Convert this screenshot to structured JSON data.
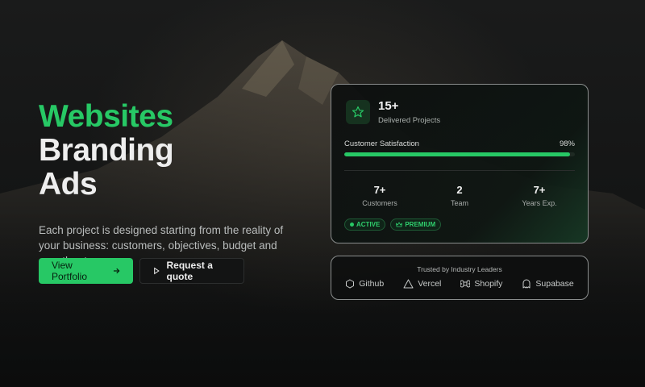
{
  "hero": {
    "line1": "Websites",
    "line2": "Branding",
    "line3": "Ads",
    "description": "Each project is designed starting from the reality of your business: customers, objectives, budget and growth rate."
  },
  "cta": {
    "primary_label": "View Portfolio",
    "secondary_label": "Request a quote"
  },
  "stats_card": {
    "projects_count": "15+",
    "projects_label": "Delivered Projects",
    "satisfaction_label": "Customer Satisfaction",
    "satisfaction_value": "98%",
    "satisfaction_fraction": 0.98,
    "stats": [
      {
        "value": "7+",
        "label": "Customers"
      },
      {
        "value": "2",
        "label": "Team"
      },
      {
        "value": "7+",
        "label": "Years Exp."
      }
    ],
    "badges": [
      {
        "label": "ACTIVE",
        "icon": "dot-icon"
      },
      {
        "label": "PREMIUM",
        "icon": "crown-icon"
      }
    ]
  },
  "trust": {
    "title": "Trusted by Industry Leaders",
    "logos": [
      {
        "label": "Github",
        "icon": "hexagon-icon"
      },
      {
        "label": "Vercel",
        "icon": "triangle-icon"
      },
      {
        "label": "Shopify",
        "icon": "command-icon"
      },
      {
        "label": "Supabase",
        "icon": "ghost-icon"
      }
    ]
  },
  "colors": {
    "accent": "#27c865",
    "background": "#0f1010",
    "text": "#eeeeee"
  }
}
